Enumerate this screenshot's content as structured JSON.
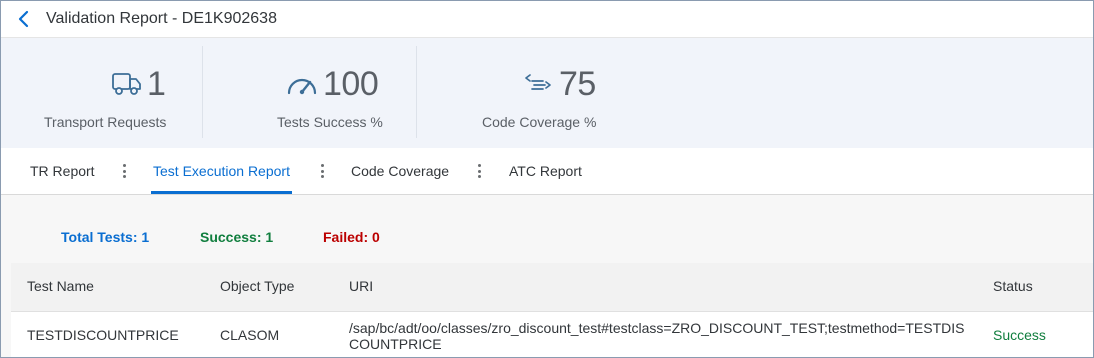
{
  "header": {
    "title": "Validation Report - DE1K902638"
  },
  "kpis": [
    {
      "icon": "truck-icon",
      "value": "1",
      "label": "Transport Requests"
    },
    {
      "icon": "speedometer-icon",
      "value": "100",
      "label": "Tests Success %"
    },
    {
      "icon": "code-coverage-icon",
      "value": "75",
      "label": "Code Coverage %"
    }
  ],
  "tabs": [
    {
      "label": "TR Report",
      "active": false
    },
    {
      "label": "Test Execution Report",
      "active": true
    },
    {
      "label": "Code Coverage",
      "active": false
    },
    {
      "label": "ATC Report",
      "active": false
    }
  ],
  "summary": {
    "total": "Total Tests: 1",
    "success": "Success: 1",
    "failed": "Failed: 0",
    "colors": {
      "total": "#0a6ed1",
      "success": "#107e3e",
      "failed": "#bb0000"
    }
  },
  "table": {
    "columns": [
      "Test Name",
      "Object Type",
      "URI",
      "Status"
    ],
    "rows": [
      {
        "test_name": "TESTDISCOUNTPRICE",
        "object_type": "CLASOM",
        "uri_line1": "/sap/bc/adt/oo/classes/zro_discount_test#testclass=ZRO_DISCOUNT_TEST;testmethod=TESTDIS",
        "uri_line2": "COUNTPRICE",
        "status": "Success"
      }
    ]
  }
}
